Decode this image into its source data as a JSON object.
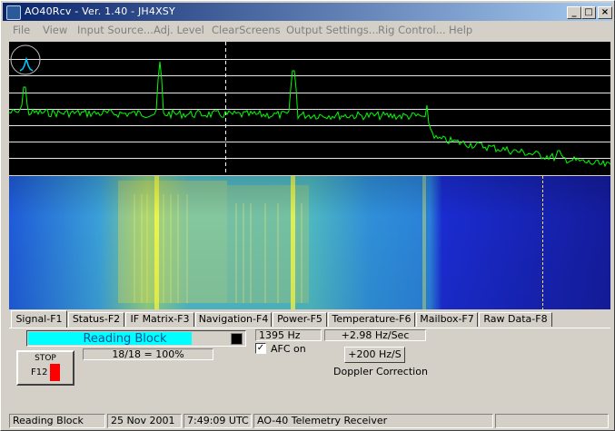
{
  "window": {
    "title": "AO40Rcv - Ver. 1.40 - JH4XSY",
    "controls": {
      "minimize": "_",
      "maximize": "□",
      "close": "×"
    }
  },
  "menu": {
    "items": [
      "File",
      "View",
      "Input Source...",
      "Adj. Level",
      "ClearScreens",
      "Output Settings...",
      "Rig Control...",
      "Help"
    ]
  },
  "tabs": [
    "Signal-F1",
    "Status-F2",
    "IF Matrix-F3",
    "Navigation-F4",
    "Power-F5",
    "Temperature-F6",
    "Mailbox-F7",
    "Raw Data-F8"
  ],
  "signal_panel": {
    "status_text": "Reading Block",
    "progress_text": "18/18 = 100%",
    "frequency": "1395 Hz",
    "drift_rate": "+2.98 Hz/Sec",
    "afc_label": "AFC on",
    "afc_checked": true,
    "afc_check_glyph": "✓",
    "doppler_value": "+200 Hz/S",
    "doppler_label": "Doppler Correction",
    "stop_button": {
      "label": "STOP",
      "key": "F12"
    }
  },
  "status_bar": {
    "state": "Reading Block",
    "date": "25 Nov 2001",
    "time": "7:49:09 UTC",
    "app_name": "AO-40 Telemetry Receiver"
  },
  "colors": {
    "spectrum_trace": "#00ff00",
    "spectrum_bg": "#000000",
    "waterfall_base": "#1a2cc0",
    "signal_fill": "#00ffff",
    "stop_indicator": "#ff0000"
  }
}
